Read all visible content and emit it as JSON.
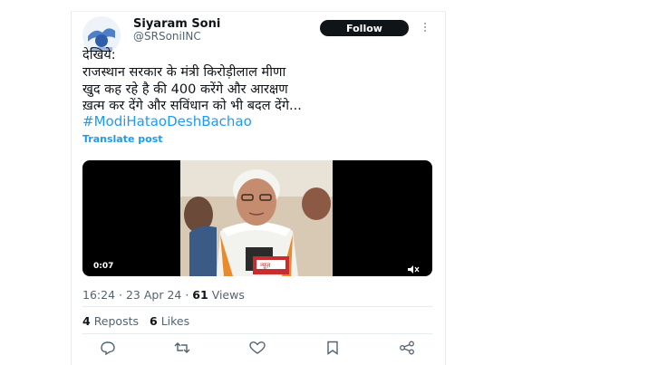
{
  "author": {
    "name": "Siyaram Soni",
    "handle": "@SRSoniINC",
    "follow_label": "Follow"
  },
  "post": {
    "lines": [
      "देखिये:",
      "राजस्थान सरकार के मंत्री किरोड़ीलाल मीणा",
      "खुद कह रहे है की 400 करेंगे और आरक्षण",
      "ख़त्म कर देंगे और सविंधान को भी बदल देंगे..."
    ],
    "hashtag": "#ModiHataoDeshBachao",
    "translate_label": "Translate post"
  },
  "video": {
    "time": "0:07",
    "mic_label": "न्यूज़"
  },
  "meta": {
    "time": "16:24",
    "date": "23 Apr 24",
    "views_count": "61",
    "views_label": "Views"
  },
  "stats": {
    "reposts_count": "4",
    "reposts_label": "Reposts",
    "likes_count": "6",
    "likes_label": "Likes"
  },
  "icons": [
    "reply-icon",
    "repost-icon",
    "like-icon",
    "bookmark-icon",
    "share-icon",
    "volume-icon",
    "more-icon"
  ],
  "colors": {
    "link": "#1d9bf0",
    "text": "#0f1419",
    "muted": "#536471",
    "button": "#0f1419"
  }
}
